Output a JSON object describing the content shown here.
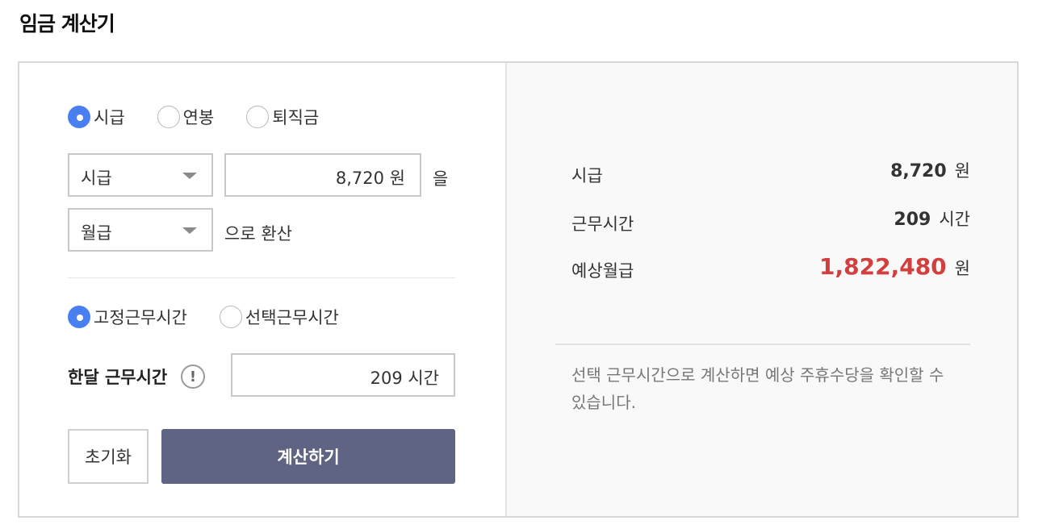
{
  "title": "임금 계산기",
  "wage_type": {
    "options": [
      "시급",
      "연봉",
      "퇴직금"
    ],
    "selected": "시급"
  },
  "from_select": {
    "value": "시급"
  },
  "amount": {
    "value": "8,720 원",
    "suffix": "을"
  },
  "to_select": {
    "value": "월급"
  },
  "convert_label": "으로 환산",
  "work_type": {
    "options": [
      "고정근무시간",
      "선택근무시간"
    ],
    "selected": "고정근무시간"
  },
  "monthly_hours": {
    "label": "한달 근무시간",
    "info_icon": "!",
    "value": "209 시간"
  },
  "buttons": {
    "reset": "초기화",
    "calculate": "계산하기"
  },
  "result": {
    "hourly": {
      "label": "시급",
      "value": "8,720",
      "unit": "원"
    },
    "hours": {
      "label": "근무시간",
      "value": "209",
      "unit": "시간"
    },
    "monthly": {
      "label": "예상월급",
      "value": "1,822,480",
      "unit": "원"
    },
    "highlight_color": "#d23f3f"
  },
  "note": "선택 근무시간으로 계산하면 예상 주휴수당을 확인할 수 있습니다.",
  "colors": {
    "accent": "#4a7ff2",
    "button": "#5f6482"
  }
}
